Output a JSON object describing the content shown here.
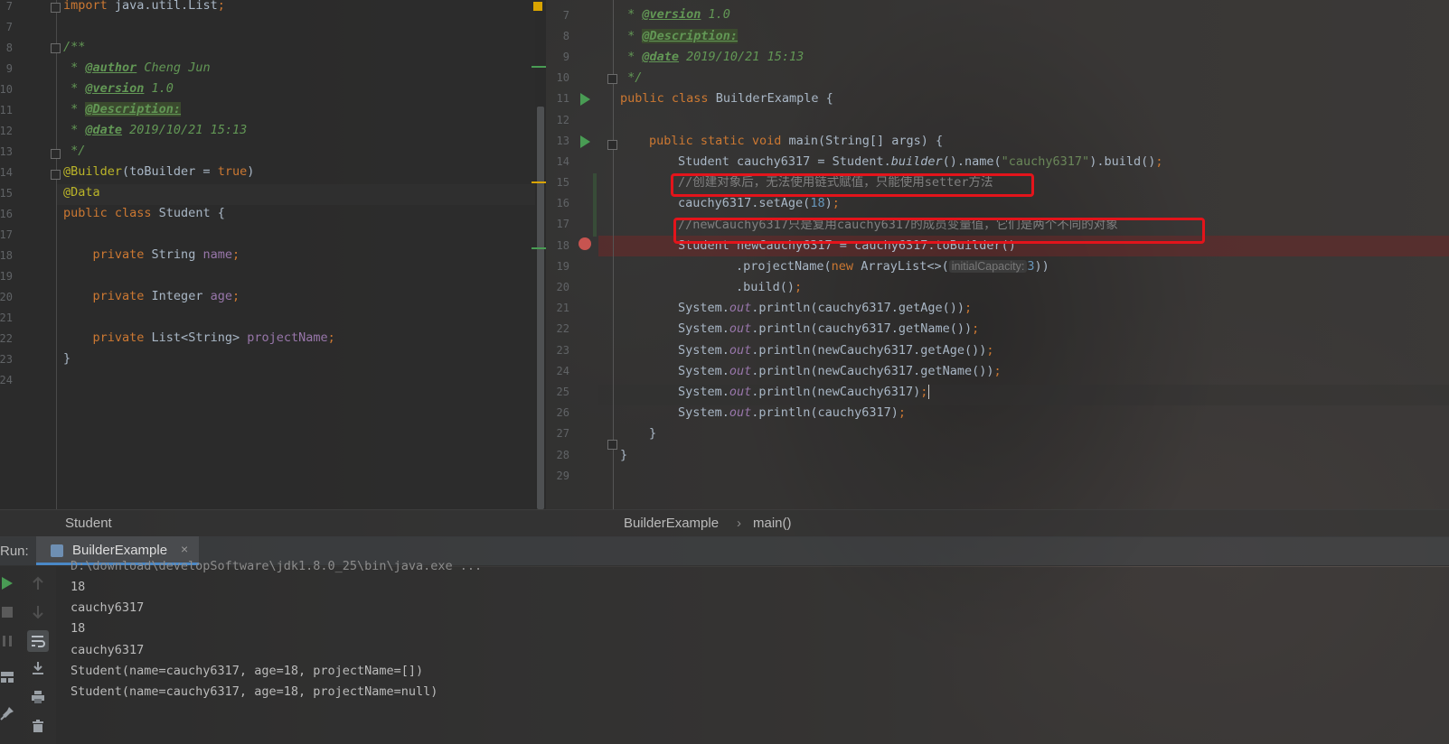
{
  "left_editor": {
    "lines": [
      {
        "n": "7",
        "t": "import java.util.List;"
      },
      {
        "n": "7",
        "t": ""
      },
      {
        "n": "8",
        "t": "/**"
      },
      {
        "n": "9",
        "t": " * @author Cheng Jun"
      },
      {
        "n": "10",
        "t": " * @version 1.0"
      },
      {
        "n": "11",
        "t": " * @Description:"
      },
      {
        "n": "12",
        "t": " * @date 2019/10/21 15:13"
      },
      {
        "n": "13",
        "t": " */"
      },
      {
        "n": "14",
        "t": "@Builder(toBuilder = true)"
      },
      {
        "n": "15",
        "t": "@Data"
      },
      {
        "n": "16",
        "t": "public class Student {"
      },
      {
        "n": "17",
        "t": ""
      },
      {
        "n": "18",
        "t": "    private String name;"
      },
      {
        "n": "19",
        "t": ""
      },
      {
        "n": "20",
        "t": "    private Integer age;"
      },
      {
        "n": "21",
        "t": ""
      },
      {
        "n": "22",
        "t": "    private List<String> projectName;"
      },
      {
        "n": "23",
        "t": "}"
      },
      {
        "n": "24",
        "t": ""
      }
    ],
    "breadcrumb": "Student"
  },
  "right_editor": {
    "line_numbers": [
      "7",
      "8",
      "9",
      "10",
      "11",
      "12",
      "13",
      "14",
      "15",
      "16",
      "17",
      "18",
      "19",
      "20",
      "21",
      "22",
      "23",
      "24",
      "25",
      "26",
      "27",
      "28",
      "29"
    ],
    "tokens": {
      "version_tag": "@version",
      "version_val": " 1.0",
      "desc_tag": "@Description:",
      "date_tag": "@date",
      "date_val": " 2019/10/21 15:13",
      "comment_end": " */",
      "kw_public": "public",
      "kw_class": "class",
      "class_name": " BuilderExample {",
      "kw_static": "static",
      "kw_void": "void",
      "main_sig": " main(String[] args) {",
      "l14_a": "Student cauchy6317 = Student.",
      "l14_builder": "builder",
      "l14_b": "().name(",
      "l14_str": "\"cauchy6317\"",
      "l14_c": ").build()",
      "l15_comment": "//创建对象后，无法使用链式赋值，只能使用setter方法",
      "l16_a": "cauchy6317.setAge(",
      "l16_num": "18",
      "l16_b": ")",
      "l17_comment": "//newCauchy6317只是复用cauchy6317的成员变量值，它们是两个不同的对象",
      "l18": "Student newCauchy6317 = cauchy6317.toBuilder()",
      "l19_a": ".projectName(",
      "l19_new": "new",
      "l19_b": " ArrayList<>(",
      "l19_hint": "initialCapacity:",
      "l19_num": "3",
      "l19_c": "))",
      "l20": ".build()",
      "sys": "System.",
      "out": "out",
      "l21": ".println(cauchy6317.getAge())",
      "l22": ".println(cauchy6317.getName())",
      "l23": ".println(newCauchy6317.getAge())",
      "l24": ".println(newCauchy6317.getName())",
      "l25": ".println(newCauchy6317)",
      "l26": ".println(cauchy6317)",
      "semi": ";",
      "l27": "}",
      "l28": "}"
    },
    "breadcrumb_class": "BuilderExample",
    "breadcrumb_sep": "›",
    "breadcrumb_method": "main()"
  },
  "run_panel": {
    "label": "Run:",
    "tab_label": "BuilderExample",
    "tab_close": "×",
    "console": [
      "D:\\download\\developSoftware\\jdk1.8.0_25\\bin\\java.exe ...",
      "18",
      "cauchy6317",
      "18",
      "cauchy6317",
      "Student(name=cauchy6317, age=18, projectName=[])",
      "Student(name=cauchy6317, age=18, projectName=null)"
    ]
  },
  "icons": {
    "run": "play-icon",
    "stop": "stop-icon",
    "pause": "pause-icon",
    "layout": "layout-icon",
    "pin": "pin-icon",
    "up": "arrow-up-icon",
    "down": "arrow-down-icon",
    "wrap": "soft-wrap-icon",
    "scroll_end": "scroll-to-end-icon",
    "print": "print-icon",
    "trash": "trash-icon"
  },
  "colors": {
    "keyword": "#cc7832",
    "comment": "#629755",
    "annotation": "#bbb529",
    "field": "#9876aa",
    "string": "#6a8759",
    "number": "#6897bb",
    "highlight_box": "#e3141b",
    "breakpoint": "#c75450"
  }
}
